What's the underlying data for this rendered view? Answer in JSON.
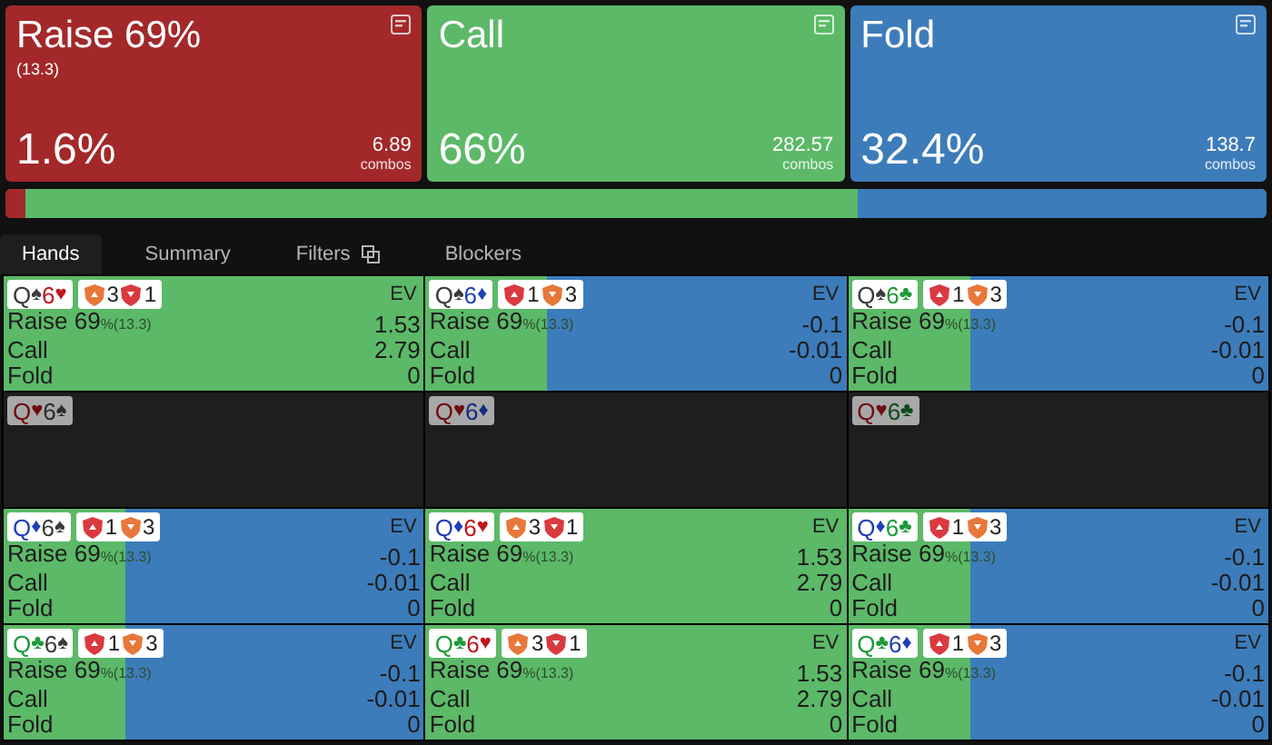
{
  "actions": [
    {
      "title": "Raise 69%",
      "subtitle": "(13.3)",
      "percent": "1.6%",
      "combos": "6.89",
      "combos_label": "combos",
      "color": "#a3282a"
    },
    {
      "title": "Call",
      "percent": "66%",
      "combos": "282.57",
      "combos_label": "combos",
      "color": "#5cb968"
    },
    {
      "title": "Fold",
      "percent": "32.4%",
      "combos": "138.7",
      "combos_label": "combos",
      "color": "#3d7cba"
    }
  ],
  "strategy_bar": [
    {
      "level": 0.016,
      "color": "#a3282a"
    },
    {
      "color": "#5cb968"
    },
    {
      "level": 0.324,
      "color": "#3d7cba"
    }
  ],
  "tabs": [
    {
      "label": "Hands",
      "selected": true
    },
    {
      "label": "Summary",
      "selected": false
    },
    {
      "label": "Filters",
      "selected": false,
      "icon": true
    },
    {
      "label": "Blockers",
      "selected": false
    }
  ],
  "cells": [
    {
      "inactive": false,
      "cards": [
        {
          "rank": "Q",
          "suit": "♠",
          "kind": "spade"
        },
        {
          "rank": "6",
          "suit": "♥",
          "kind": "heart"
        }
      ],
      "blockers": [
        {
          "kind": "up",
          "color": "#e8773a",
          "count": "3"
        },
        {
          "kind": "down",
          "color": "#d93a3f",
          "count": "1"
        }
      ],
      "ev": "EV",
      "level": 1,
      "lines": [
        {
          "label": "Raise 69",
          "note": "%(13.3)",
          "value": "1.53"
        },
        {
          "label": "Call",
          "value": "2.79"
        },
        {
          "label": "Fold",
          "value": "0"
        }
      ]
    },
    {
      "inactive": false,
      "cards": [
        {
          "rank": "Q",
          "suit": "♠",
          "kind": "spade"
        },
        {
          "rank": "6",
          "suit": "♦",
          "kind": "diamond"
        }
      ],
      "blockers": [
        {
          "kind": "up",
          "color": "#d93a3f",
          "count": "1"
        },
        {
          "kind": "down",
          "color": "#e8773a",
          "count": "3"
        }
      ],
      "ev": "EV",
      "level": 0.29,
      "lines": [
        {
          "label": "Raise 69",
          "note": "%(13.3)",
          "value": "-0.1"
        },
        {
          "label": "Call",
          "value": "-0.01"
        },
        {
          "label": "Fold",
          "value": "0"
        }
      ]
    },
    {
      "inactive": false,
      "cards": [
        {
          "rank": "Q",
          "suit": "♠",
          "kind": "spade"
        },
        {
          "rank": "6",
          "suit": "♣",
          "kind": "club"
        }
      ],
      "blockers": [
        {
          "kind": "up",
          "color": "#d93a3f",
          "count": "1"
        },
        {
          "kind": "down",
          "color": "#e8773a",
          "count": "3"
        }
      ],
      "ev": "EV",
      "level": 0.29,
      "lines": [
        {
          "label": "Raise 69",
          "note": "%(13.3)",
          "value": "-0.1"
        },
        {
          "label": "Call",
          "value": "-0.01"
        },
        {
          "label": "Fold",
          "value": "0"
        }
      ]
    },
    {
      "inactive": true,
      "cards": [
        {
          "rank": "Q",
          "suit": "♥",
          "kind": "heart"
        },
        {
          "rank": "6",
          "suit": "♠",
          "kind": "spade"
        }
      ]
    },
    {
      "inactive": true,
      "cards": [
        {
          "rank": "Q",
          "suit": "♥",
          "kind": "heart"
        },
        {
          "rank": "6",
          "suit": "♦",
          "kind": "diamond"
        }
      ]
    },
    {
      "inactive": true,
      "cards": [
        {
          "rank": "Q",
          "suit": "♥",
          "kind": "heart"
        },
        {
          "rank": "6",
          "suit": "♣",
          "kind": "club"
        }
      ]
    },
    {
      "inactive": false,
      "cards": [
        {
          "rank": "Q",
          "suit": "♦",
          "kind": "diamond"
        },
        {
          "rank": "6",
          "suit": "♠",
          "kind": "spade"
        }
      ],
      "blockers": [
        {
          "kind": "up",
          "color": "#d93a3f",
          "count": "1"
        },
        {
          "kind": "down",
          "color": "#e8773a",
          "count": "3"
        }
      ],
      "ev": "EV",
      "level": 0.29,
      "lines": [
        {
          "label": "Raise 69",
          "note": "%(13.3)",
          "value": "-0.1"
        },
        {
          "label": "Call",
          "value": "-0.01"
        },
        {
          "label": "Fold",
          "value": "0"
        }
      ]
    },
    {
      "inactive": false,
      "cards": [
        {
          "rank": "Q",
          "suit": "♦",
          "kind": "diamond"
        },
        {
          "rank": "6",
          "suit": "♥",
          "kind": "heart"
        }
      ],
      "blockers": [
        {
          "kind": "up",
          "color": "#e8773a",
          "count": "3"
        },
        {
          "kind": "down",
          "color": "#d93a3f",
          "count": "1"
        }
      ],
      "ev": "EV",
      "level": 1,
      "lines": [
        {
          "label": "Raise 69",
          "note": "%(13.3)",
          "value": "1.53"
        },
        {
          "label": "Call",
          "value": "2.79"
        },
        {
          "label": "Fold",
          "value": "0"
        }
      ]
    },
    {
      "inactive": false,
      "cards": [
        {
          "rank": "Q",
          "suit": "♦",
          "kind": "diamond"
        },
        {
          "rank": "6",
          "suit": "♣",
          "kind": "club"
        }
      ],
      "blockers": [
        {
          "kind": "up",
          "color": "#d93a3f",
          "count": "1"
        },
        {
          "kind": "down",
          "color": "#e8773a",
          "count": "3"
        }
      ],
      "ev": "EV",
      "level": 0.29,
      "lines": [
        {
          "label": "Raise 69",
          "note": "%(13.3)",
          "value": "-0.1"
        },
        {
          "label": "Call",
          "value": "-0.01"
        },
        {
          "label": "Fold",
          "value": "0"
        }
      ]
    },
    {
      "inactive": false,
      "cards": [
        {
          "rank": "Q",
          "suit": "♣",
          "kind": "club"
        },
        {
          "rank": "6",
          "suit": "♠",
          "kind": "spade"
        }
      ],
      "blockers": [
        {
          "kind": "up",
          "color": "#d93a3f",
          "count": "1"
        },
        {
          "kind": "down",
          "color": "#e8773a",
          "count": "3"
        }
      ],
      "ev": "EV",
      "level": 0.29,
      "lines": [
        {
          "label": "Raise 69",
          "note": "%(13.3)",
          "value": "-0.1"
        },
        {
          "label": "Call",
          "value": "-0.01"
        },
        {
          "label": "Fold",
          "value": "0"
        }
      ]
    },
    {
      "inactive": false,
      "cards": [
        {
          "rank": "Q",
          "suit": "♣",
          "kind": "club"
        },
        {
          "rank": "6",
          "suit": "♥",
          "kind": "heart"
        }
      ],
      "blockers": [
        {
          "kind": "up",
          "color": "#e8773a",
          "count": "3"
        },
        {
          "kind": "down",
          "color": "#d93a3f",
          "count": "1"
        }
      ],
      "ev": "EV",
      "level": 1,
      "lines": [
        {
          "label": "Raise 69",
          "note": "%(13.3)",
          "value": "1.53"
        },
        {
          "label": "Call",
          "value": "2.79"
        },
        {
          "label": "Fold",
          "value": "0"
        }
      ]
    },
    {
      "inactive": false,
      "cards": [
        {
          "rank": "Q",
          "suit": "♣",
          "kind": "club"
        },
        {
          "rank": "6",
          "suit": "♦",
          "kind": "diamond"
        }
      ],
      "blockers": [
        {
          "kind": "up",
          "color": "#d93a3f",
          "count": "1"
        },
        {
          "kind": "down",
          "color": "#e8773a",
          "count": "3"
        }
      ],
      "ev": "EV",
      "level": 0.29,
      "lines": [
        {
          "label": "Raise 69",
          "note": "%(13.3)",
          "value": "-0.1"
        },
        {
          "label": "Call",
          "value": "-0.01"
        },
        {
          "label": "Fold",
          "value": "0"
        }
      ]
    }
  ]
}
